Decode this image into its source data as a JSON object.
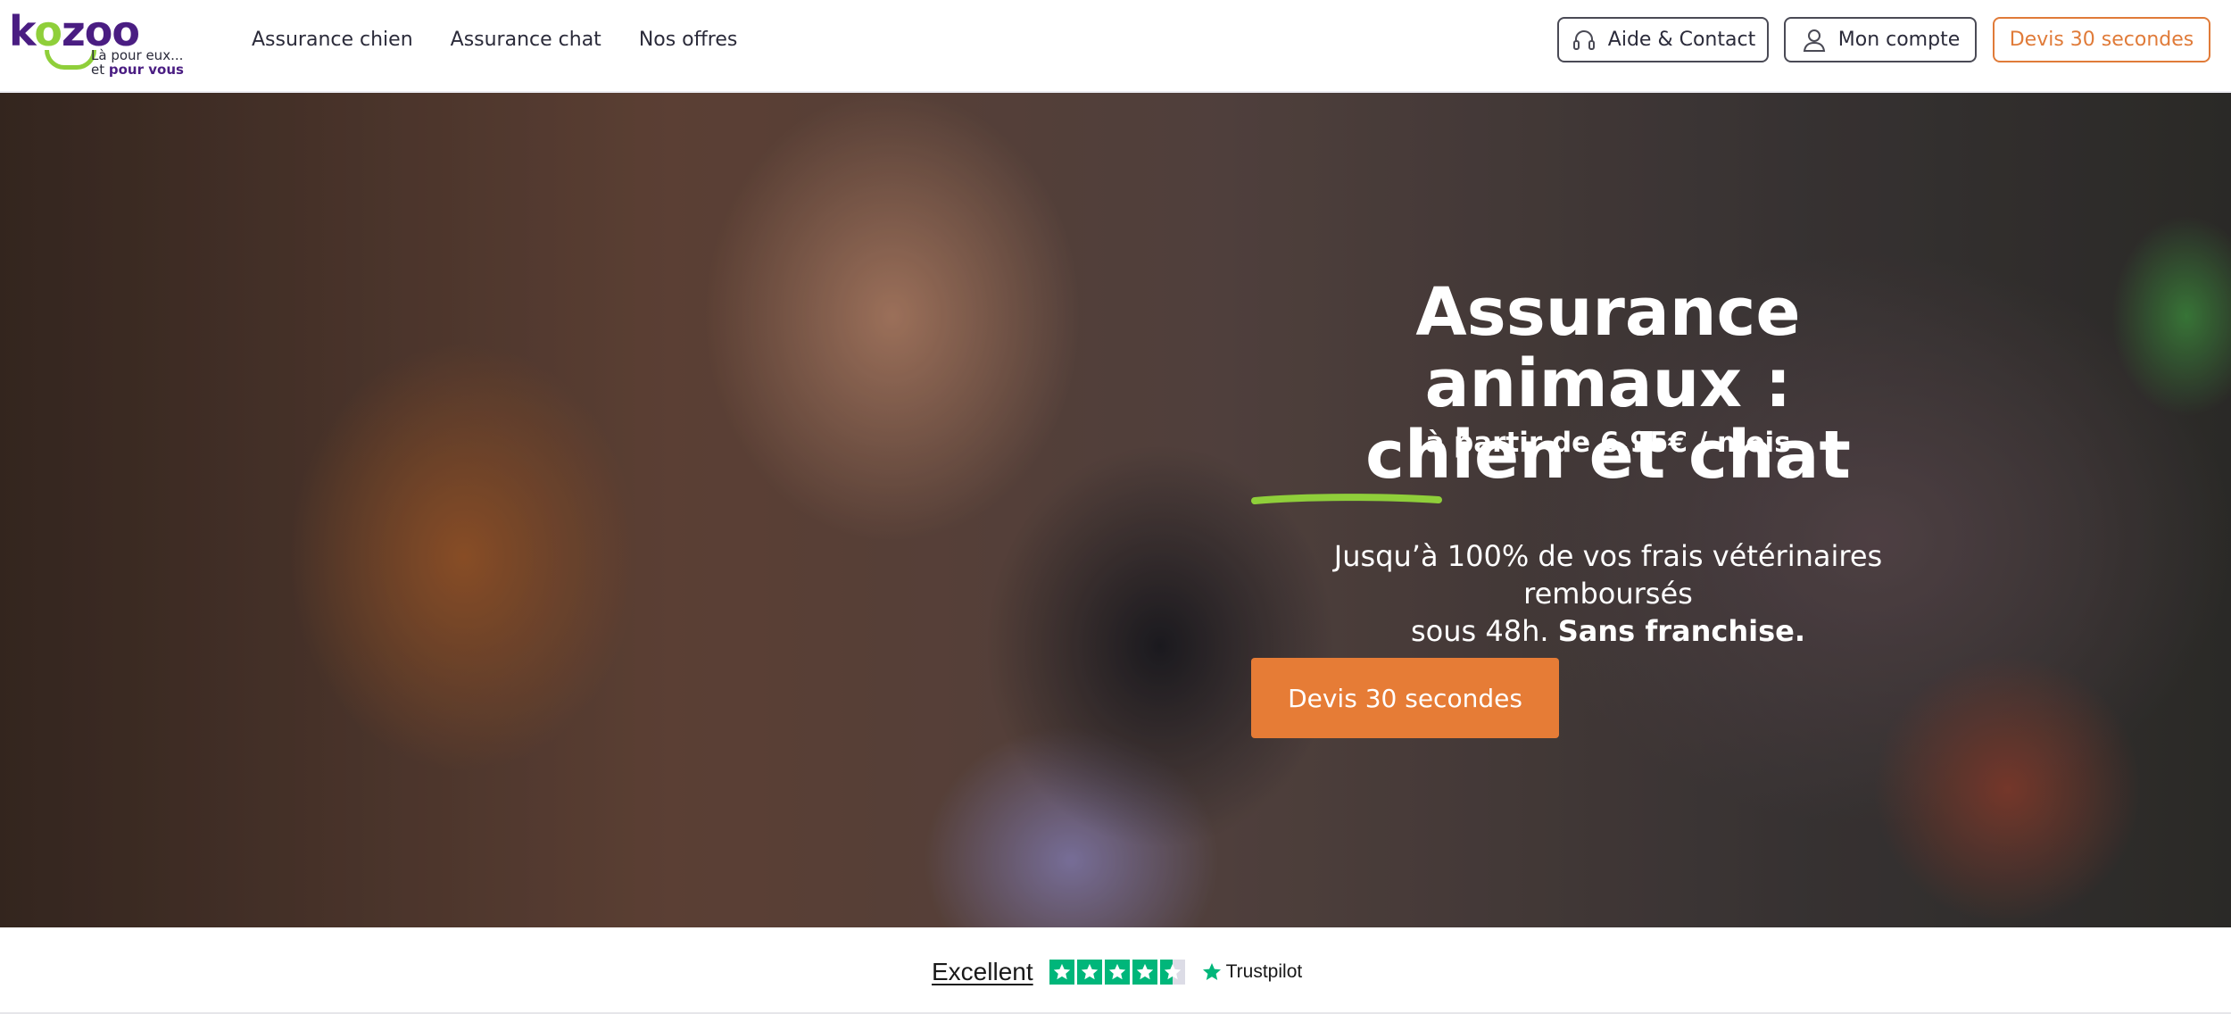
{
  "logo": {
    "brand_k": "k",
    "brand_o1": "o",
    "brand_z": "z",
    "brand_oo": "oo",
    "tagline_1": "Là pour eux...",
    "tagline_2a": "et ",
    "tagline_2b": "pour vous"
  },
  "nav": {
    "items": [
      {
        "label": "Assurance chien"
      },
      {
        "label": "Assurance chat"
      },
      {
        "label": "Nos offres"
      }
    ]
  },
  "header_buttons": {
    "help": "Aide & Contact",
    "account": "Mon compte",
    "quote": "Devis 30 secondes"
  },
  "hero": {
    "title_1": "Assurance animaux :",
    "title_2": "chien et chat",
    "price": "à partir de 6,95€ / mois",
    "desc_1": "Jusqu’à 100% de vos frais vétérinaires remboursés",
    "desc_2a": "sous 48h. ",
    "desc_2b": "Sans franchise.",
    "cta": "Devis 30 secondes"
  },
  "trustpilot": {
    "label": "Excellent",
    "rating_stars": 4.5,
    "brand": "Trustpilot"
  },
  "colors": {
    "brand_purple": "#4a1d82",
    "brand_green": "#8fcf3a",
    "accent_orange": "#e67c36",
    "trustpilot_green": "#00b67a"
  }
}
